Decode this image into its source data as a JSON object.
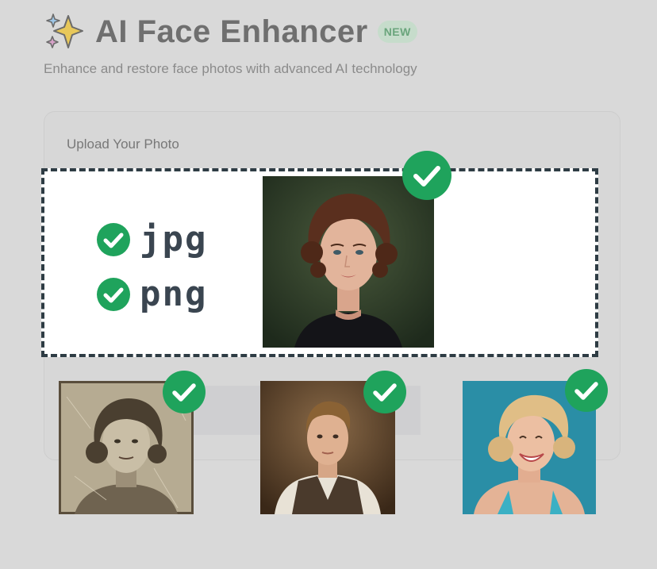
{
  "header": {
    "title": "AI Face Enhancer",
    "badge": "NEW",
    "subtitle": "Enhance and restore face photos with advanced AI technology",
    "icon": "sparkles-icon"
  },
  "upload": {
    "label": "Upload Your Photo",
    "formats": [
      "jpg",
      "png"
    ]
  },
  "colors": {
    "check_green": "#1fa35c",
    "dashed_border": "#2e3c44",
    "badge_bg": "#c6dccb",
    "badge_text": "#6aa57c"
  }
}
